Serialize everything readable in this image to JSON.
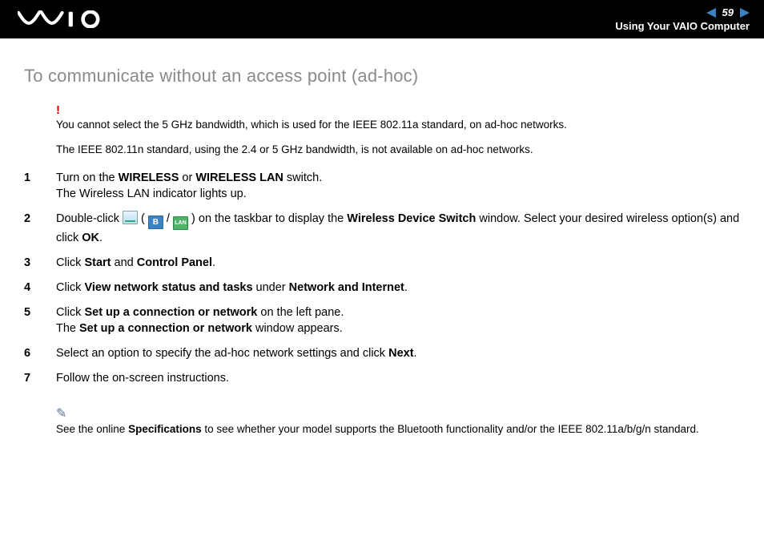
{
  "header": {
    "page_number": "59",
    "section": "Using Your VAIO Computer"
  },
  "title": "To communicate without an access point (ad-hoc)",
  "warning": "You cannot select the 5 GHz bandwidth, which is used for the IEEE 802.11a standard, on ad-hoc networks.",
  "info": "The IEEE 802.11n standard, using the 2.4 or 5 GHz bandwidth, is not available on ad-hoc networks.",
  "steps": [
    {
      "n": "1",
      "pre": "Turn on the ",
      "b1": "WIRELESS",
      "mid": " or ",
      "b2": "WIRELESS LAN",
      "post": " switch.",
      "line2": "The Wireless LAN indicator lights up."
    },
    {
      "n": "2",
      "pre": "Double-click ",
      "mid": " on the taskbar to display the ",
      "b1": "Wireless Device Switch",
      "post": " window. Select your desired wireless option(s) and click ",
      "b2": "OK",
      "end": "."
    },
    {
      "n": "3",
      "pre": "Click ",
      "b1": "Start",
      "mid": " and ",
      "b2": "Control Panel",
      "end": "."
    },
    {
      "n": "4",
      "pre": "Click ",
      "b1": "View network status and tasks",
      "mid": " under ",
      "b2": "Network and Internet",
      "end": "."
    },
    {
      "n": "5",
      "pre": "Click ",
      "b1": "Set up a connection or network",
      "post": " on the left pane.",
      "line2pre": "The ",
      "line2b": "Set up a connection or network",
      "line2post": " window appears."
    },
    {
      "n": "6",
      "pre": "Select an option to specify the ad-hoc network settings and click ",
      "b1": "Next",
      "end": "."
    },
    {
      "n": "7",
      "pre": "Follow the on-screen instructions."
    }
  ],
  "tip": {
    "pre": "See the online ",
    "b": "Specifications",
    "post": " to see whether your model supports the Bluetooth functionality and/or the IEEE 802.11a/b/g/n standard."
  },
  "icon_labels": {
    "b": "B",
    "lan": "LAN"
  }
}
